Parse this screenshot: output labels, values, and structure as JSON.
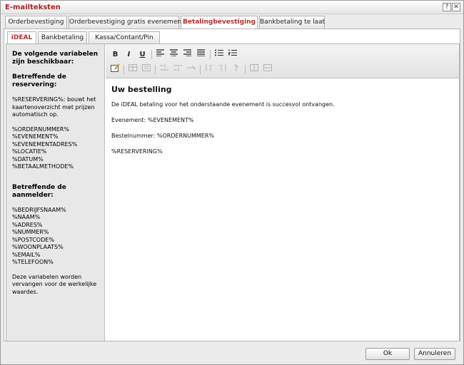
{
  "window": {
    "title": "E-mailteksten",
    "help_glyph": "?",
    "close_glyph": "✕"
  },
  "outer_tabs": [
    {
      "label": "Orderbevestiging",
      "active": false
    },
    {
      "label": "Orderbevestiging gratis evenement",
      "active": false
    },
    {
      "label": "Betalingbevestiging",
      "active": true
    },
    {
      "label": "Bankbetaling te laat",
      "active": false
    }
  ],
  "inner_tabs": [
    {
      "label": "iDEAL",
      "active": true
    },
    {
      "label": "Bankbetaling",
      "active": false
    },
    {
      "label": "Kassa/Contant/Pin",
      "active": false
    }
  ],
  "sidebar": {
    "intro": "De volgende variabelen zijn beschikbaar:",
    "section1_heading": "Betreffende de reservering:",
    "reservering_desc": "%RESERVERING%: bouwt het kaartenoverzicht met prijzen automatisch op.",
    "section1_vars": [
      "%ORDERNUMMER%",
      "%EVENEMENT%",
      "%EVENEMENTADRES%",
      "%LOCATIE%",
      "%DATUM%",
      "%BETAALMETHODE%"
    ],
    "section2_heading": "Betreffende de aanmelder:",
    "section2_vars": [
      "%BEDRIJFSNAAM%",
      "%NAAM%",
      "%ADRES%",
      "%NUMMER%",
      "%POSTCODE%",
      "%WOONPLAATS%",
      "%EMAIL%",
      "%TELEFOON%"
    ],
    "footer": "Deze variabelen worden vervangen voor de werkelijke waardes."
  },
  "toolbar": {
    "bold": "B",
    "italic": "I",
    "underline": "U"
  },
  "document": {
    "heading": "Uw bestelling",
    "line1": "De iDEAL betaling voor het onderstaande evenement is succesvol ontvangen.",
    "line2": "Evenement: %EVENEMENT%",
    "line3": "Bestelnummer: %ORDERNUMMER%",
    "line4": "%RESERVERING%"
  },
  "buttons": {
    "ok": "Ok",
    "cancel": "Annuleren"
  }
}
